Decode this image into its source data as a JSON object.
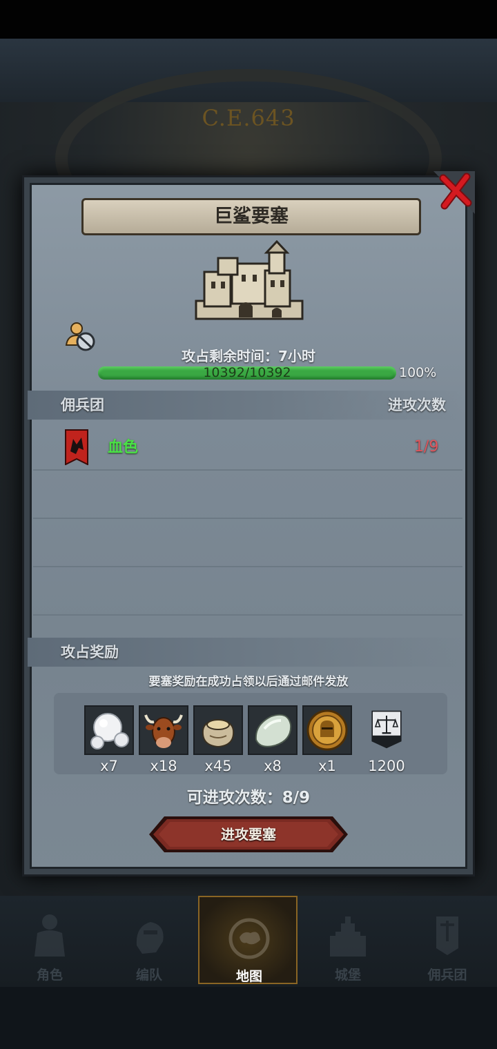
{
  "background": {
    "era_label": "C.E.643"
  },
  "modal": {
    "title": "巨鲨要塞",
    "timer": "攻占剩余时间：7小时",
    "hp_text": "10392/10392",
    "hp_percent": "100%",
    "hp_fill": 1.0,
    "mercenary_header": "佣兵团",
    "attack_count_header": "进攻次数",
    "mercenaries": [
      {
        "name": "血色",
        "count": "1/9"
      }
    ],
    "reward_header": "攻占奖励",
    "reward_note": "要塞奖励在成功占领以后通过邮件发放",
    "rewards": [
      {
        "icon": "pearl-icon",
        "qty": "x7"
      },
      {
        "icon": "ox-icon",
        "qty": "x18"
      },
      {
        "icon": "grain-sack-icon",
        "qty": "x45"
      },
      {
        "icon": "jade-stone-icon",
        "qty": "x8"
      },
      {
        "icon": "knight-medal-icon",
        "qty": "x1"
      },
      {
        "icon": "justice-banner-icon",
        "qty": "1200"
      }
    ],
    "attempts": "可进攻次数：8/9",
    "attack_button": "进攻要塞"
  },
  "nav": {
    "items": [
      {
        "label": "角色",
        "icon": "knight-icon"
      },
      {
        "label": "编队",
        "icon": "formation-icon"
      },
      {
        "label": "地图",
        "icon": "compass-map-icon",
        "active": true
      },
      {
        "label": "城堡",
        "icon": "castle-icon"
      },
      {
        "label": "佣兵团",
        "icon": "mercenary-icon"
      }
    ]
  },
  "colors": {
    "hp_green": "#3aa843",
    "ally_name": "#4ae046",
    "count_red": "#e0545b",
    "close_red": "#c8161b"
  }
}
